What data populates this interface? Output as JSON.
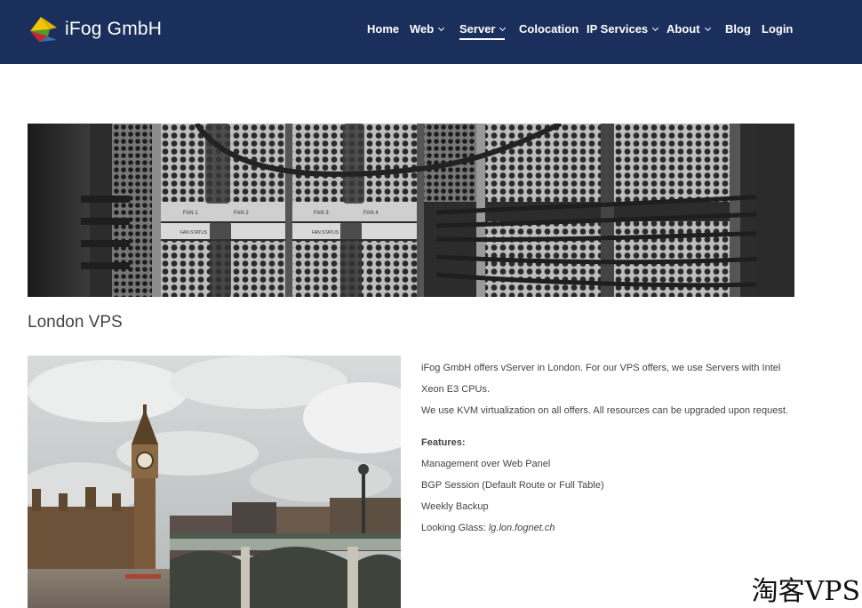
{
  "header": {
    "brand": "iFog GmbH",
    "nav": [
      {
        "label": "Home",
        "dropdown": false
      },
      {
        "label": "Web",
        "dropdown": true
      },
      {
        "label": "Server",
        "dropdown": true,
        "active": true
      },
      {
        "label": "Colocation",
        "dropdown": false
      },
      {
        "label": "IP Services",
        "dropdown": true
      },
      {
        "label": "About",
        "dropdown": true
      },
      {
        "label": "Blog",
        "dropdown": false
      },
      {
        "label": "Login",
        "dropdown": false
      }
    ]
  },
  "banner": {
    "labels": [
      "FAN 1",
      "FAN 2",
      "FAN 3",
      "FAN 4"
    ],
    "status_labels": [
      "FAN STATUS",
      "FAN STATUS"
    ]
  },
  "page": {
    "title": "London VPS",
    "intro_1": "iFog GmbH offers vServer in London. For our VPS offers, we use Servers with Intel Xeon E3 CPUs.",
    "intro_2": "We use KVM virtualization on all offers. All resources can be upgraded upon request.",
    "features_title": "Features:",
    "features": [
      "Management over Web Panel",
      "BGP Session (Default Route or Full Table)",
      "Weekly Backup"
    ],
    "looking_glass_label": "Looking Glass:",
    "looking_glass_link": "lg.lon.fognet.ch"
  },
  "watermark": "淘客VPS",
  "colors": {
    "header_bg": "#1b2f5c",
    "text": "#444444"
  }
}
